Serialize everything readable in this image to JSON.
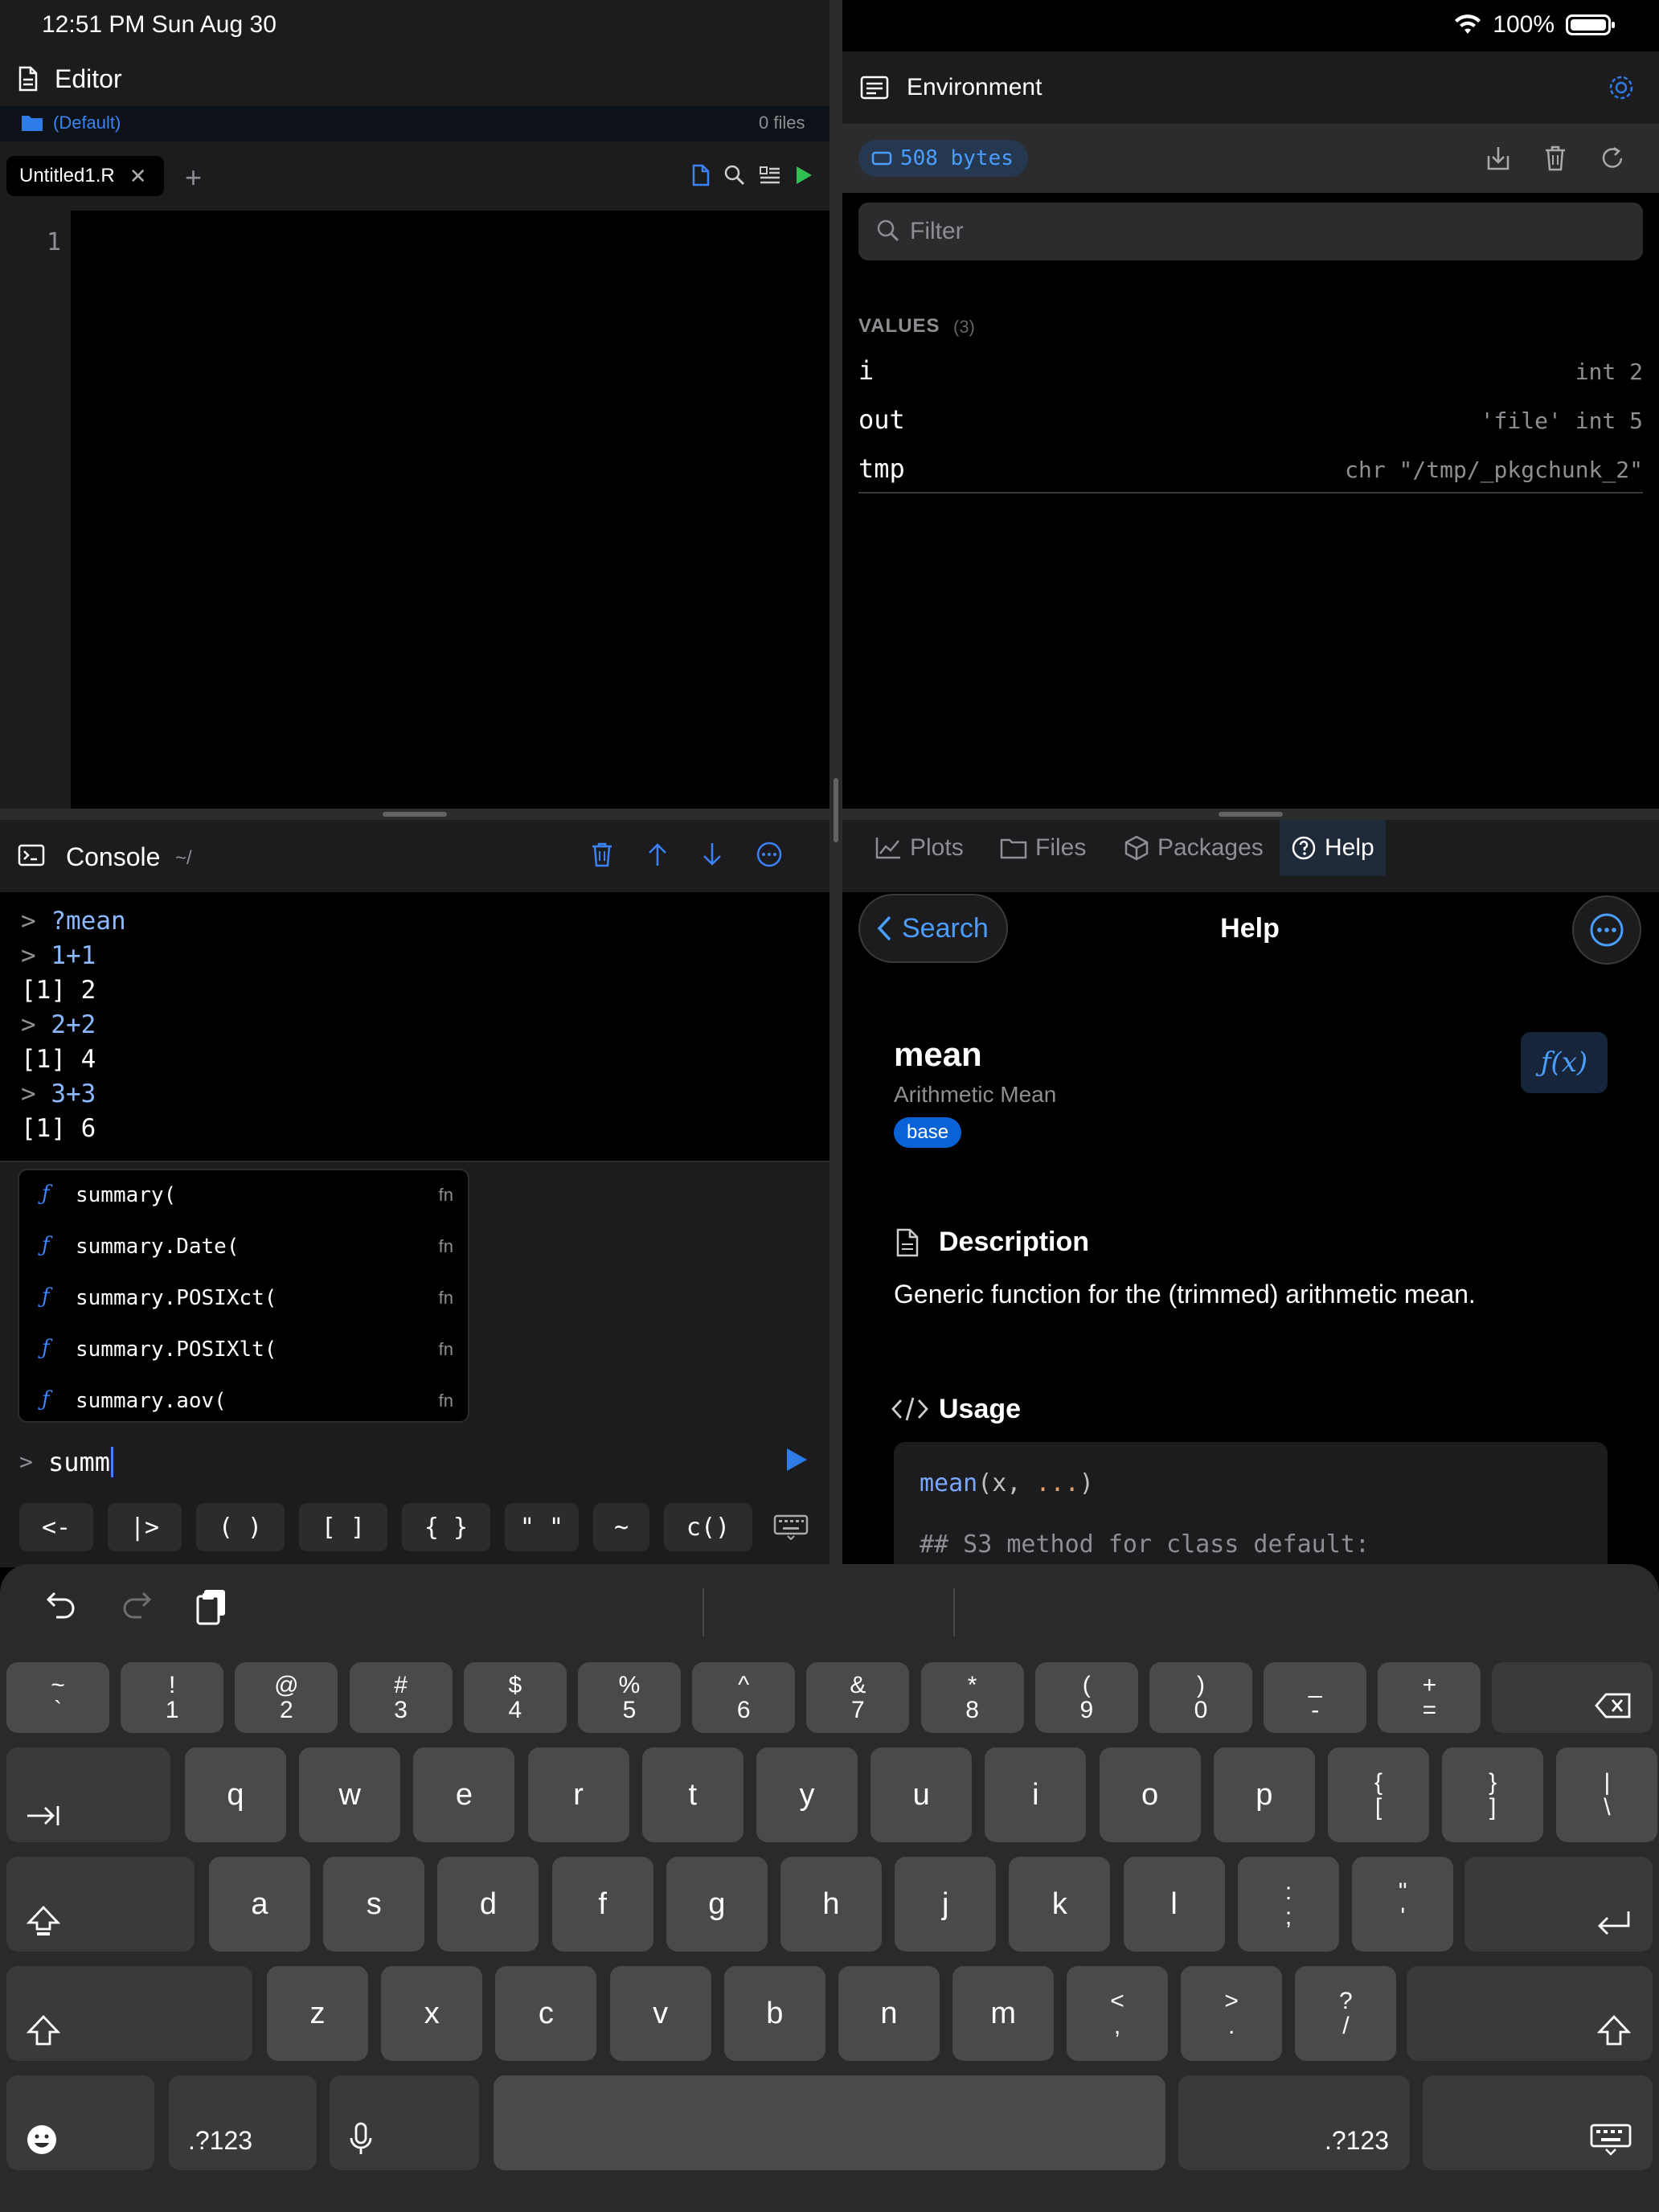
{
  "status": {
    "time": "12:51 PM   Sun Aug 30",
    "battery": "100%"
  },
  "editor": {
    "title": "Editor",
    "project": "(Default)",
    "file_count": "0 files",
    "tab": "Untitled1.R",
    "line_number": "1"
  },
  "console": {
    "title": "Console",
    "path": "~/",
    "lines": [
      {
        "prompt": ">",
        "text": "?mean"
      },
      {
        "prompt": ">",
        "text": "1+1"
      },
      {
        "prompt": "",
        "text": "[1] 2"
      },
      {
        "prompt": ">",
        "text": "2+2"
      },
      {
        "prompt": "",
        "text": "[1] 4"
      },
      {
        "prompt": ">",
        "text": "3+3"
      },
      {
        "prompt": "",
        "text": "[1] 6"
      }
    ],
    "autocomplete": [
      {
        "icon": "ƒ",
        "name": "summary(",
        "kind": "fn"
      },
      {
        "icon": "ƒ",
        "name": "summary.Date(",
        "kind": "fn"
      },
      {
        "icon": "ƒ",
        "name": "summary.POSIXct(",
        "kind": "fn"
      },
      {
        "icon": "ƒ",
        "name": "summary.POSIXlt(",
        "kind": "fn"
      },
      {
        "icon": "ƒ",
        "name": "summary.aov(",
        "kind": "fn"
      }
    ],
    "input_prompt": ">",
    "input_value": "summ",
    "snippets": [
      "<-",
      "|>",
      "( )",
      "[ ]",
      "{ }",
      "\" \"",
      "~",
      "c()"
    ]
  },
  "environment": {
    "title": "Environment",
    "size": "508 bytes",
    "filter_placeholder": "Filter",
    "values_label": "VALUES",
    "values_count": "(3)",
    "values": [
      {
        "name": "i",
        "value": "int 2"
      },
      {
        "name": "out",
        "value": "'file' int 5"
      },
      {
        "name": "tmp",
        "value": "chr \"/tmp/_pkgchunk_2\""
      }
    ]
  },
  "right_tabs": {
    "plots": "Plots",
    "files": "Files",
    "packages": "Packages",
    "help": "Help",
    "active": "Help"
  },
  "help": {
    "back_label": "Search",
    "title": "Help",
    "function_name": "mean",
    "subtitle": "Arithmetic Mean",
    "package": "base",
    "fx_label": "ƒ(x)",
    "description_heading": "Description",
    "description": "Generic function for the (trimmed) arithmetic mean.",
    "usage_heading": "Usage",
    "usage_fn": "mean",
    "usage_open": "(x, ",
    "usage_dots": "...",
    "usage_close": ")",
    "usage_comment": "## S3 method for class default:"
  },
  "keyboard": {
    "row1": [
      {
        "top": "~",
        "bottom": "`"
      },
      {
        "top": "!",
        "bottom": "1"
      },
      {
        "top": "@",
        "bottom": "2"
      },
      {
        "top": "#",
        "bottom": "3"
      },
      {
        "top": "$",
        "bottom": "4"
      },
      {
        "top": "%",
        "bottom": "5"
      },
      {
        "top": "^",
        "bottom": "6"
      },
      {
        "top": "&",
        "bottom": "7"
      },
      {
        "top": "*",
        "bottom": "8"
      },
      {
        "top": "(",
        "bottom": "9"
      },
      {
        "top": ")",
        "bottom": "0"
      },
      {
        "top": "_",
        "bottom": "-"
      },
      {
        "top": "+",
        "bottom": "="
      }
    ],
    "row2": [
      "q",
      "w",
      "e",
      "r",
      "t",
      "y",
      "u",
      "i",
      "o",
      "p"
    ],
    "row2_punct": [
      {
        "top": "{",
        "bottom": "["
      },
      {
        "top": "}",
        "bottom": "]"
      },
      {
        "top": "|",
        "bottom": "\\"
      }
    ],
    "row3": [
      "a",
      "s",
      "d",
      "f",
      "g",
      "h",
      "j",
      "k",
      "l"
    ],
    "row3_punct": [
      {
        "top": ":",
        "bottom": ";"
      },
      {
        "top": "\"",
        "bottom": "'"
      }
    ],
    "row4": [
      "z",
      "x",
      "c",
      "v",
      "b",
      "n",
      "m"
    ],
    "row4_punct": [
      {
        "top": "<",
        "bottom": ","
      },
      {
        "top": ">",
        "bottom": "."
      },
      {
        "top": "?",
        "bottom": "/"
      }
    ],
    "numbers_label": ".?123"
  }
}
